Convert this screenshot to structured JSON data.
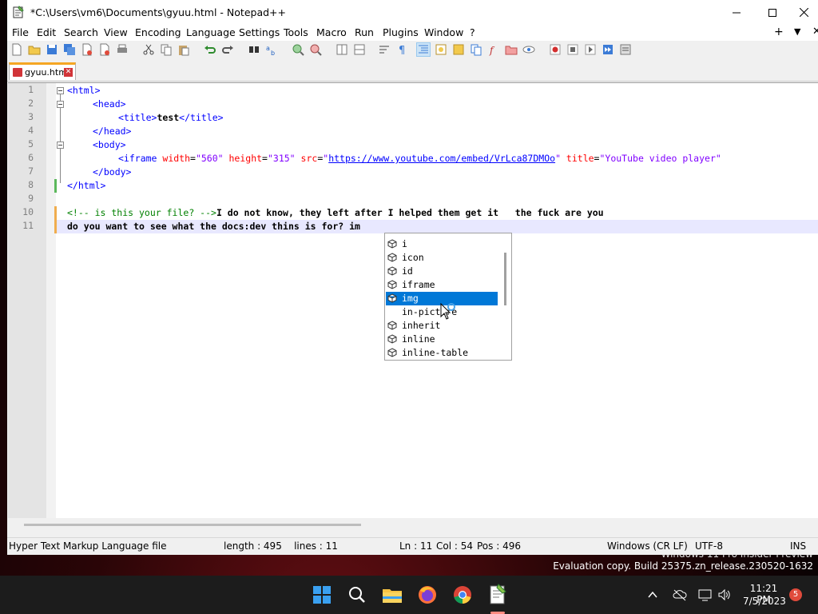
{
  "window": {
    "title": "*C:\\Users\\vm6\\Documents\\gyuu.html - Notepad++"
  },
  "menu": [
    "File",
    "Edit",
    "Search",
    "View",
    "Encoding",
    "Language",
    "Settings",
    "Tools",
    "Macro",
    "Run",
    "Plugins",
    "Window",
    "?"
  ],
  "menu_right": {
    "plus": "+",
    "down": "▼",
    "close": "✕"
  },
  "tab": {
    "label": "gyuu.html"
  },
  "line_numbers": [
    "1",
    "2",
    "3",
    "4",
    "5",
    "6",
    "7",
    "8",
    "9",
    "10",
    "11"
  ],
  "code": {
    "l1": {
      "a": "<html>"
    },
    "l2": {
      "a": "<head>"
    },
    "l3": {
      "a": "<title>",
      "b": "test",
      "c": "</title>"
    },
    "l4": {
      "a": "</head>"
    },
    "l5": {
      "a": "<body>"
    },
    "l6": {
      "a": "<iframe ",
      "b": "width",
      "c": "=",
      "d": "\"560\"",
      "e": " height",
      "f": "=",
      "g": "\"315\"",
      "h": " src",
      "i": "=",
      "j": "\"",
      "k": "https://www.youtube.com/embed/VrLca87DMOo",
      "l": "\"",
      "m": " title",
      "n": "=",
      "o": "\"YouTube video player\""
    },
    "l7": {
      "a": "</body>"
    },
    "l8": {
      "a": "</html>"
    },
    "l10": {
      "a": "<!-- is this your file? -->",
      "b": "I do not know, they left after I helped them get it   the fuck are you"
    },
    "l11": {
      "a": "do you want to see what the docs:dev thins is for? im"
    }
  },
  "autocomplete": {
    "items": [
      "i",
      "icon",
      "id",
      "iframe",
      "img",
      "in-picture",
      "inherit",
      "inline",
      "inline-table"
    ],
    "selected": "img"
  },
  "status": {
    "file_type": "Hyper Text Markup Language file",
    "length_lines": "length : 495    lines : 11",
    "ln": "Ln : 11",
    "col": "Col : 54",
    "pos": "Pos : 496",
    "eol": "Windows (CR LF)",
    "encoding": "UTF-8",
    "mode": "INS"
  },
  "desktop": {
    "watermark_line1": "Windows 11 Pro Insider Preview",
    "watermark_line2": "Evaluation copy. Build 25375.zn_release.230520-1632"
  },
  "taskbar": {
    "time": "11:21 PM",
    "date": "7/5/2023",
    "badge": "5"
  },
  "colors": {
    "accent": "#0078d7",
    "tab_accent": "#f5a623",
    "tag": "#0000ff",
    "attr": "#ff0000",
    "string": "#8000ff",
    "comment": "#008000"
  }
}
